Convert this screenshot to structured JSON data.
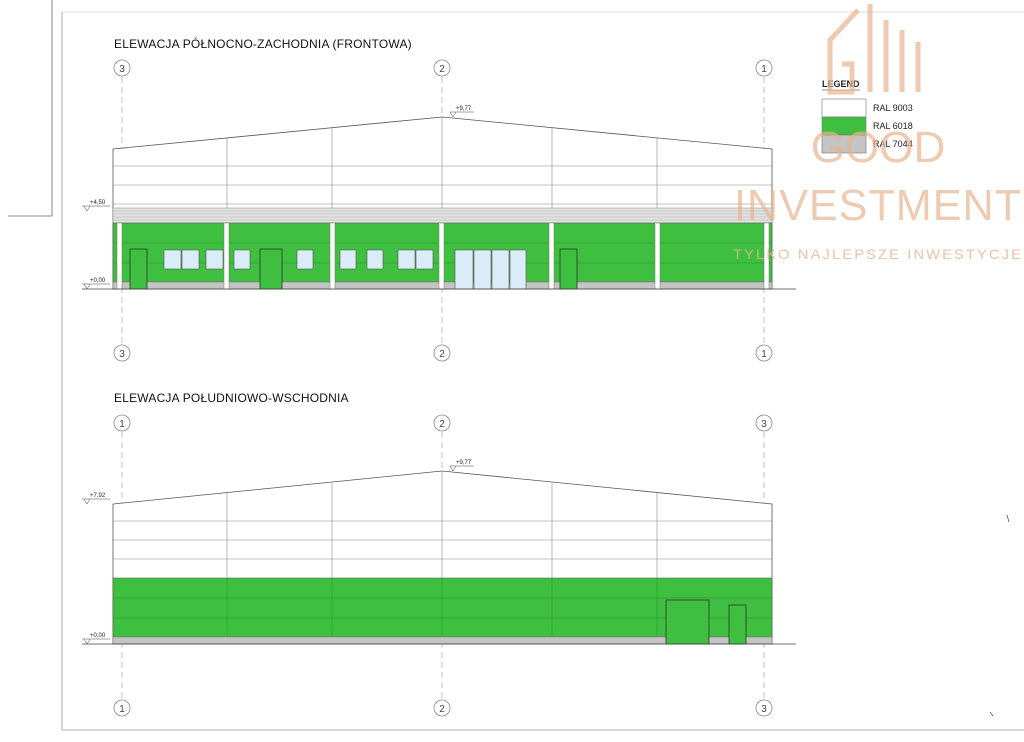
{
  "drawing": {
    "elevation_1": {
      "title": "ELEWACJA PÓŁNOCNO-ZACHODNIA (FRONTOWA)",
      "axes": [
        "3",
        "2",
        "1"
      ],
      "level_top": "+9,77",
      "level_mid": "+4,50",
      "level_base": "+0,00"
    },
    "elevation_2": {
      "title": "ELEWACJA POŁUDNIOWO-WSCHODNIA",
      "axes": [
        "1",
        "2",
        "3"
      ],
      "level_top": "+9,77",
      "level_mid": "+7,92",
      "level_base": "+0,00"
    }
  },
  "legend": {
    "title": "LEGEND",
    "items": [
      {
        "label": "RAL 9003",
        "color": "#ffffff"
      },
      {
        "label": "RAL 6018",
        "color": "#3fbf3f"
      },
      {
        "label": "RAL 7044",
        "color": "#c4c4c4"
      }
    ]
  },
  "watermark": {
    "line1": "GOOD",
    "line2": "INVESTMENT",
    "tagline": "TYLKO NAJLEPSZE INWESTYCJE"
  },
  "colors": {
    "facade_green": "#3fbf3f",
    "plinth_grey": "#c4c4c4",
    "window_blue": "#d9ecf7",
    "brand_accent": "#e7b48f"
  }
}
